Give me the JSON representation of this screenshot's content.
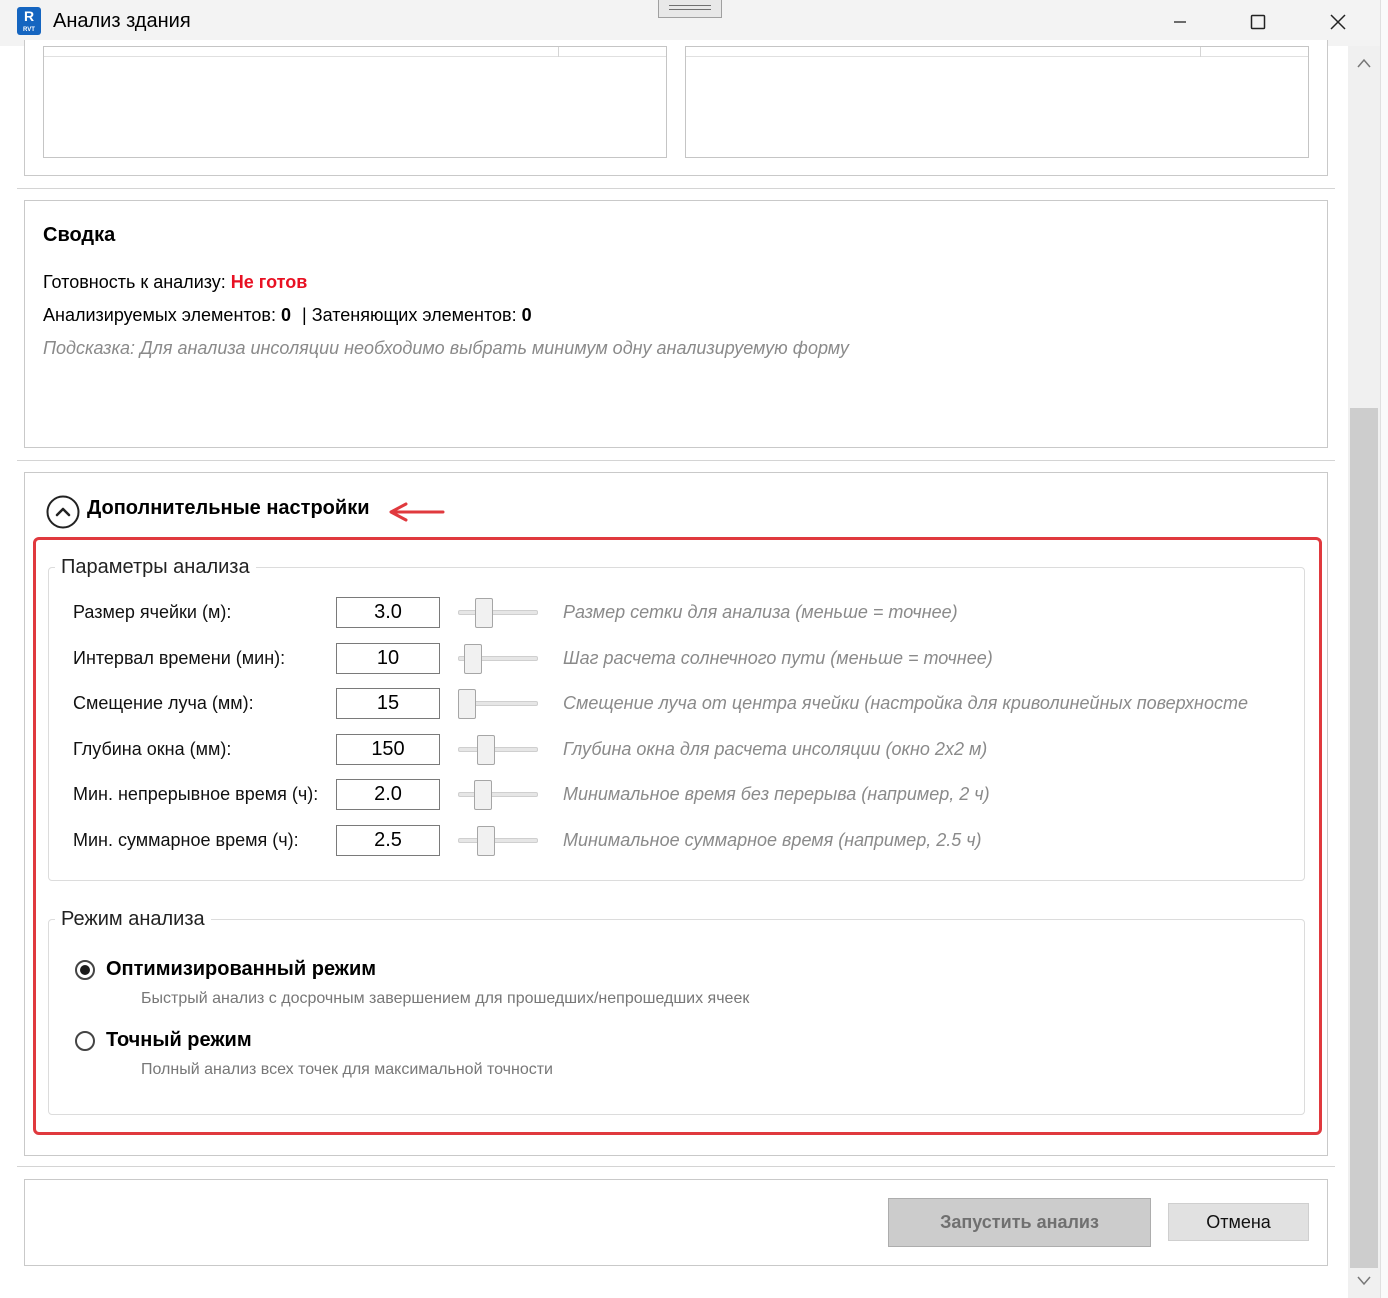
{
  "window": {
    "title": "Анализ здания",
    "icon_letter": "R",
    "icon_sub": "RVT"
  },
  "summary": {
    "title": "Сводка",
    "readiness_label": "Готовность к анализу: ",
    "readiness_value": "Не готов",
    "analyzed_label": "Анализируемых элементов: ",
    "analyzed_value": "0",
    "separator": "|",
    "shading_label": "Затеняющих элементов: ",
    "shading_value": "0",
    "hint": "Подсказка: Для анализа инсоляции необходимо выбрать минимум одну анализируемую форму"
  },
  "advanced": {
    "title": "Дополнительные настройки",
    "expanded": true
  },
  "params": {
    "legend": "Параметры анализа",
    "rows": [
      {
        "label": "Размер ячейки (м):",
        "value": "3.0",
        "slider": 0.27,
        "desc": "Размер сетки для анализа (меньше = точнее)"
      },
      {
        "label": "Интервал времени (мин):",
        "value": "10",
        "slider": 0.1,
        "desc": "Шаг расчета солнечного пути (меньше = точнее)"
      },
      {
        "label": "Смещение луча (мм):",
        "value": "15",
        "slider": 0.0,
        "desc": "Смещение луча от центра ячейки (настройка для криволинейных поверхносте"
      },
      {
        "label": "Глубина окна (мм):",
        "value": "150",
        "slider": 0.3,
        "desc": "Глубина окна для расчета инсоляции (окно 2x2 м)"
      },
      {
        "label": "Мин. непрерывное время (ч):",
        "value": "2.0",
        "slider": 0.25,
        "desc": "Минимальное время без перерыва (например, 2 ч)"
      },
      {
        "label": "Мин. суммарное время (ч):",
        "value": "2.5",
        "slider": 0.3,
        "desc": "Минимальное суммарное время (например, 2.5 ч)"
      }
    ]
  },
  "mode": {
    "legend": "Режим анализа",
    "options": [
      {
        "label": "Оптимизированный режим",
        "desc": "Быстрый анализ с досрочным завершением для прошедших/непрошедших ячеек",
        "checked": true
      },
      {
        "label": "Точный режим",
        "desc": "Полный анализ всех точек для максимальной точности",
        "checked": false
      }
    ]
  },
  "buttons": {
    "run": "Запустить анализ",
    "cancel": "Отмена"
  },
  "colors": {
    "error": "#e81123",
    "annotation": "#e0393e",
    "hint": "#8a8a8a"
  }
}
